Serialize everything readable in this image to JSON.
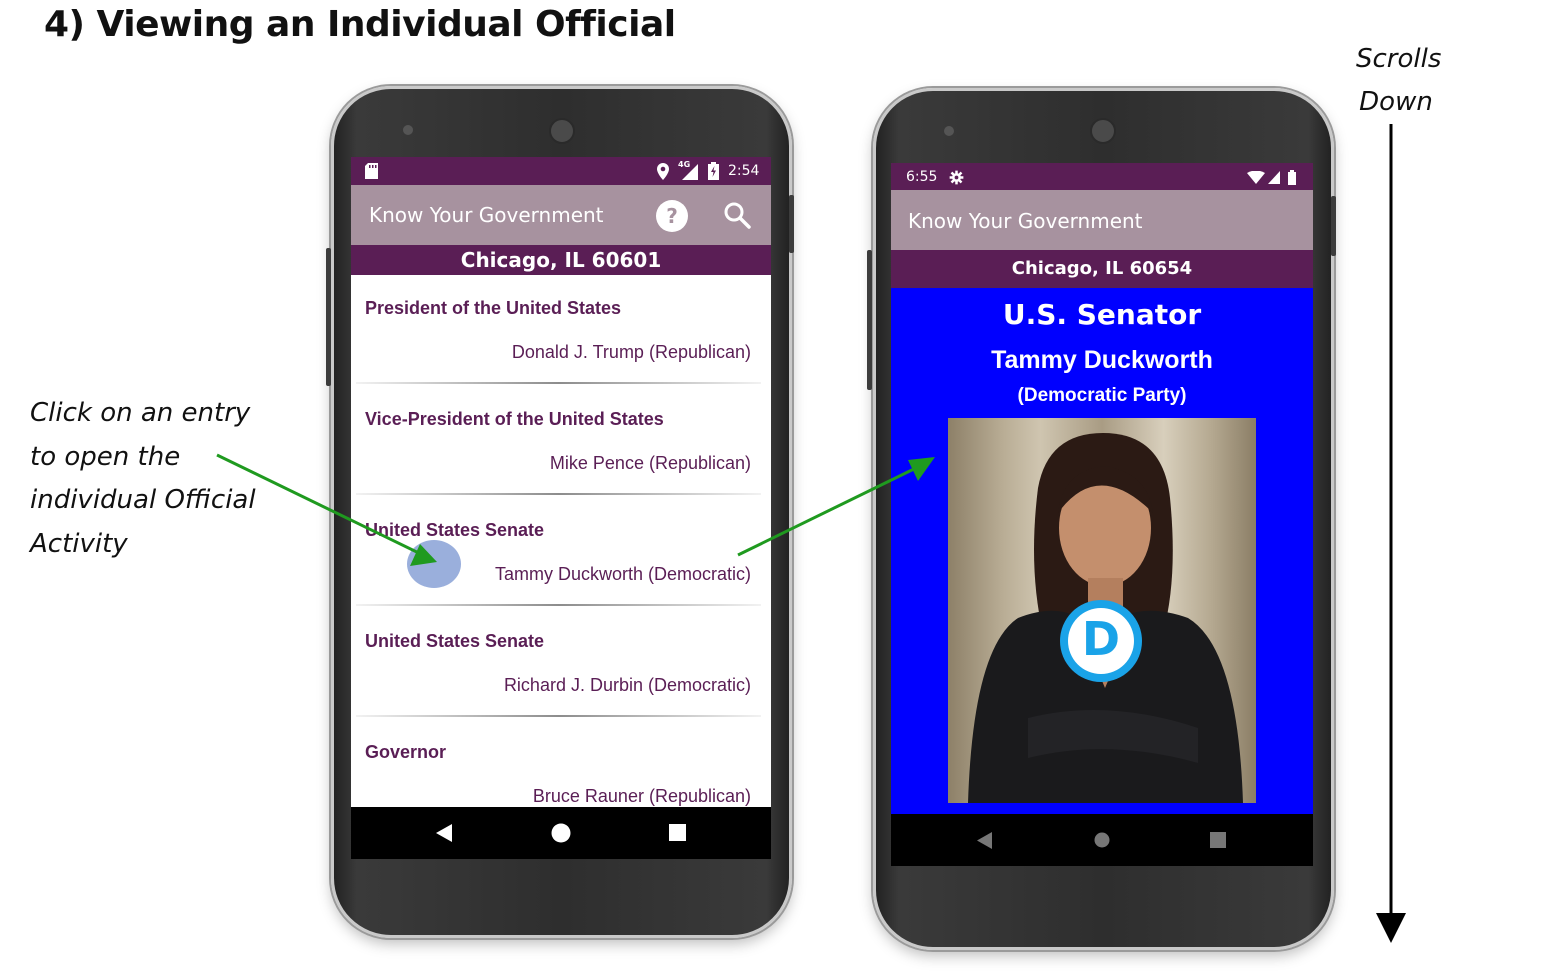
{
  "heading": "4)  Viewing an Individual Official",
  "instruction_lines": [
    "Click on an entry",
    "to open the",
    "individual Official",
    "Activity"
  ],
  "scroll_note_lines": [
    "Scrolls",
    "Down"
  ],
  "colors": {
    "accent": "#5a1e55",
    "appbar": "#a7929f",
    "detail_bg": "#0000ff",
    "arrow": "#1f9a1f",
    "touch": "#8fa6d8"
  },
  "left_phone": {
    "status_time": "2:54",
    "network_label": "4G",
    "app_title": "Know Your Government",
    "help_icon": "help-circle-icon",
    "search_icon": "search-icon",
    "location": "Chicago, IL 60601",
    "officials": [
      {
        "office": "President of the United States",
        "name": "Donald J. Trump (Republican)"
      },
      {
        "office": "Vice-President of the United States",
        "name": "Mike Pence (Republican)"
      },
      {
        "office": "United States Senate",
        "name": "Tammy Duckworth (Democratic)"
      },
      {
        "office": "United States Senate",
        "name": "Richard J. Durbin (Democratic)"
      },
      {
        "office": "Governor",
        "name": "Bruce Rauner (Republican)"
      }
    ]
  },
  "right_phone": {
    "status_time": "6:55",
    "app_title": "Know Your Government",
    "location": "Chicago, IL 60654",
    "office": "U.S. Senator",
    "name": "Tammy Duckworth",
    "party": "(Democratic Party)",
    "party_logo_letter": "D"
  }
}
